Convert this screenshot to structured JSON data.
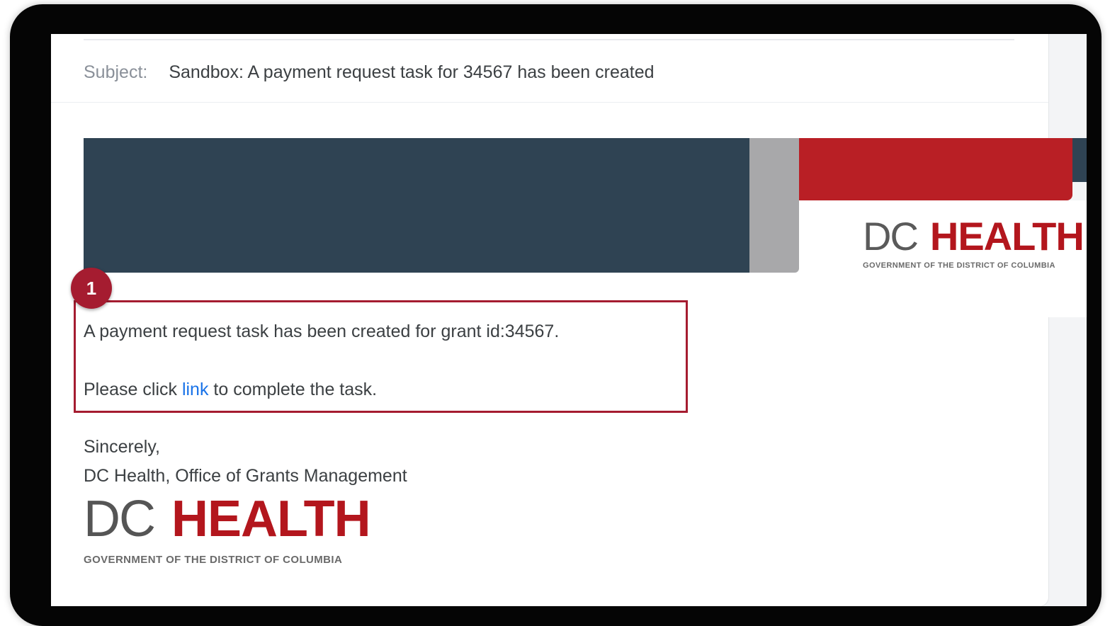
{
  "email": {
    "subject_label": "Subject:",
    "subject": "Sandbox: A payment request task for 34567 has been created",
    "body_line1": "A payment request task has been created for grant id:34567.",
    "body_line2_prefix": "Please click ",
    "body_line2_link": "link",
    "body_line2_suffix": " to complete the task.",
    "closing": "Sincerely,",
    "signature": "DC Health, Office of Grants Management"
  },
  "logo": {
    "dc": "DC",
    "health": "HEALTH",
    "tagline": "GOVERNMENT OF THE DISTRICT OF COLUMBIA"
  },
  "callout": {
    "number": "1"
  },
  "colors": {
    "accent": "#a51c30",
    "brand_red": "#b91f25",
    "banner_navy": "#2f4353",
    "link": "#1a73e8"
  }
}
